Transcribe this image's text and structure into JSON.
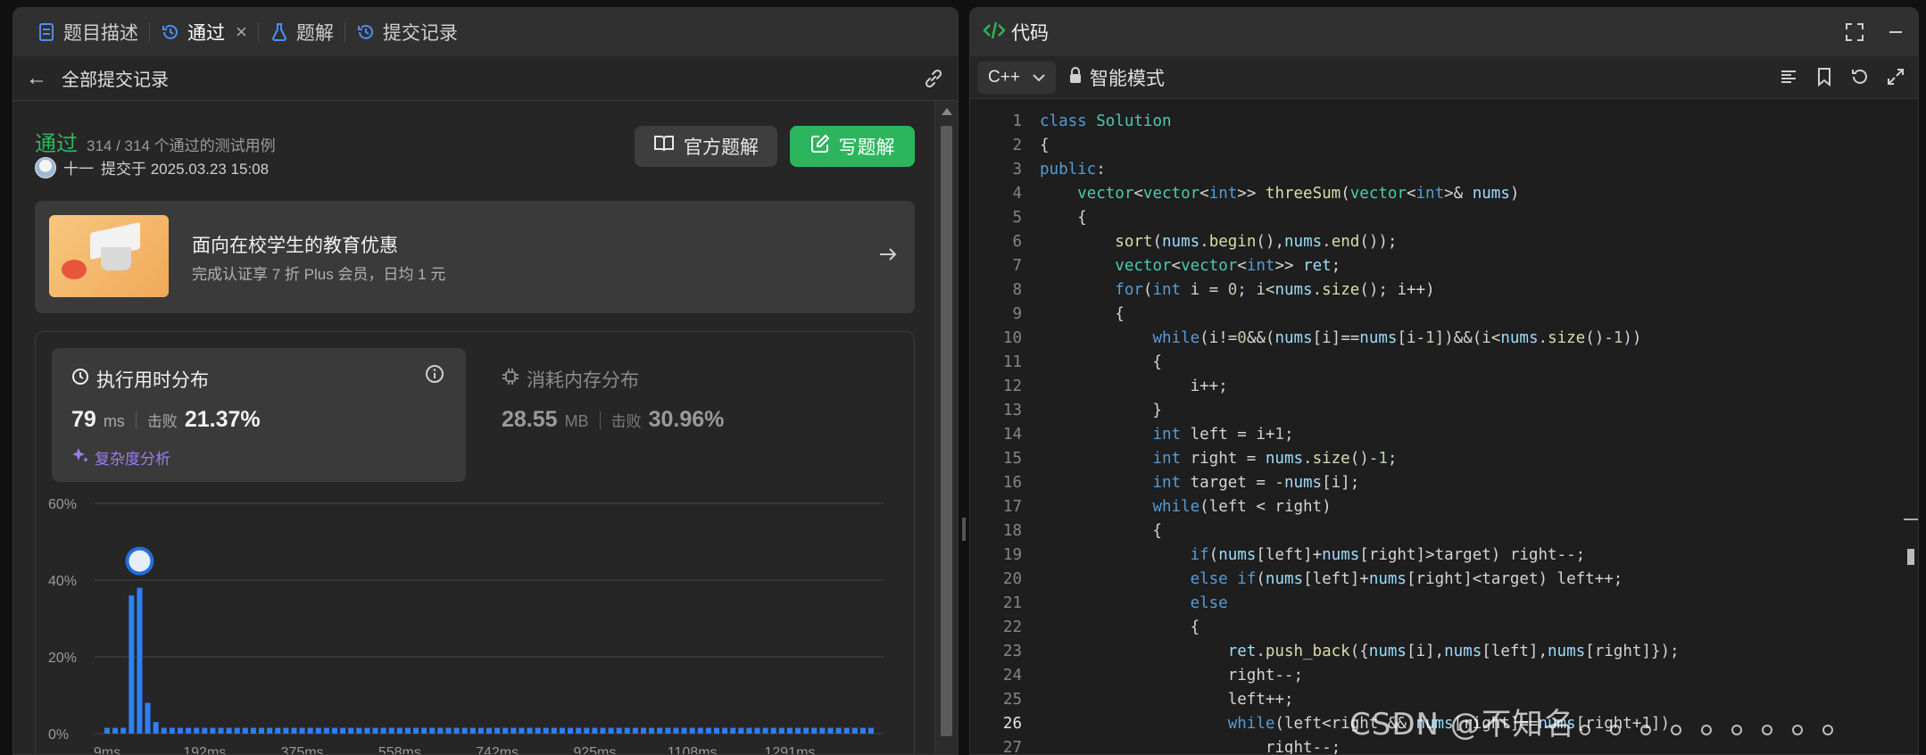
{
  "left_tabs": [
    {
      "label": "题目描述",
      "icon": "doc-icon"
    },
    {
      "label": "通过",
      "icon": "history-icon"
    },
    {
      "label": "题解",
      "icon": "flask-icon"
    },
    {
      "label": "提交记录",
      "icon": "history-icon"
    }
  ],
  "subbar": {
    "title": "全部提交记录"
  },
  "submission": {
    "status": "通过",
    "cases": "314 / 314 个通过的测试用例",
    "user": "十一",
    "submitted_at": "提交于 2025.03.23 15:08"
  },
  "buttons": {
    "official": "官方题解",
    "write": "写题解"
  },
  "promo": {
    "title": "面向在校学生的教育优惠",
    "subtitle": "完成认证享 7 折 Plus 会员，日均 1 元"
  },
  "runtime": {
    "title": "执行用时分布",
    "value": "79",
    "unit": "ms",
    "beat_label": "击败",
    "beat": "21.37%",
    "complexity": "复杂度分析"
  },
  "memory": {
    "title": "消耗内存分布",
    "value": "28.55",
    "unit": "MB",
    "beat_label": "击败",
    "beat": "30.96%"
  },
  "chart_data": {
    "type": "bar",
    "title": "",
    "xlabel": "",
    "ylabel": "",
    "ylim": [
      0,
      60
    ],
    "yticks": [
      "0%",
      "20%",
      "40%",
      "60%"
    ],
    "xticks": [
      "9ms",
      "192ms",
      "375ms",
      "558ms",
      "742ms",
      "925ms",
      "1108ms",
      "1291ms"
    ],
    "values": [
      1.5,
      1.5,
      1.5,
      36,
      38,
      8,
      3,
      1.5,
      1.5,
      1.5,
      1.5,
      1.5,
      1.5,
      1.5,
      1.5,
      1.5,
      1.5,
      1.5,
      1.5,
      1.5,
      1.5,
      1.5,
      1.5,
      1.5,
      1.5,
      1.5,
      1.5,
      1.5,
      1.5,
      1.5,
      1.5,
      1.5,
      1.5,
      1.5,
      1.5,
      1.5,
      1.5,
      1.5,
      1.5,
      1.5,
      1.5,
      1.5,
      1.5,
      1.5,
      1.5,
      1.5,
      1.5,
      1.5,
      1.5,
      1.5,
      1.5,
      1.5,
      1.5,
      1.5,
      1.5,
      1.5,
      1.5,
      1.5,
      1.5,
      1.5,
      1.5,
      1.5,
      1.5,
      1.5,
      1.5,
      1.5,
      1.5,
      1.5,
      1.5,
      1.5,
      1.5,
      1.5,
      1.5,
      1.5,
      1.5,
      1.5,
      1.5,
      1.5,
      1.5,
      1.5,
      1.5,
      1.5,
      1.5,
      1.5,
      1.5,
      1.5,
      1.5,
      1.5,
      1.5,
      1.5,
      1.5,
      1.5,
      1.5,
      1.5,
      1.5
    ],
    "grid": true,
    "bar_color": "#2f7ff5",
    "marker_bar_index": 4
  },
  "editor": {
    "title": "代码",
    "language": "C++",
    "mode": "智能模式",
    "current_line": 26,
    "lines": [
      "class Solution",
      "{",
      "public:",
      "    vector<vector<int>> threeSum(vector<int>& nums)",
      "    {",
      "        sort(nums.begin(),nums.end());",
      "        vector<vector<int>> ret;",
      "        for(int i = 0; i<nums.size(); i++)",
      "        {",
      "            while(i!=0&&(nums[i]==nums[i-1])&&(i<nums.size()-1))",
      "            {",
      "                i++;",
      "            }",
      "            int left = i+1;",
      "            int right = nums.size()-1;",
      "            int target = -nums[i];",
      "            while(left < right)",
      "            {",
      "                if(nums[left]+nums[right]>target) right--;",
      "                else if(nums[left]+nums[right]<target) left++;",
      "                else",
      "                {",
      "                    ret.push_back({nums[i],nums[left],nums[right]});",
      "                    right--;",
      "                    left++;",
      "                    while(left<right && nums[right]==nums[right+1])",
      "                        right--;"
    ]
  },
  "watermark": "CSDN @不知名",
  "colors": {
    "accent_green": "#2db55d",
    "bar_blue": "#2f7ff5",
    "complexity_purple": "#9b7cf3"
  }
}
